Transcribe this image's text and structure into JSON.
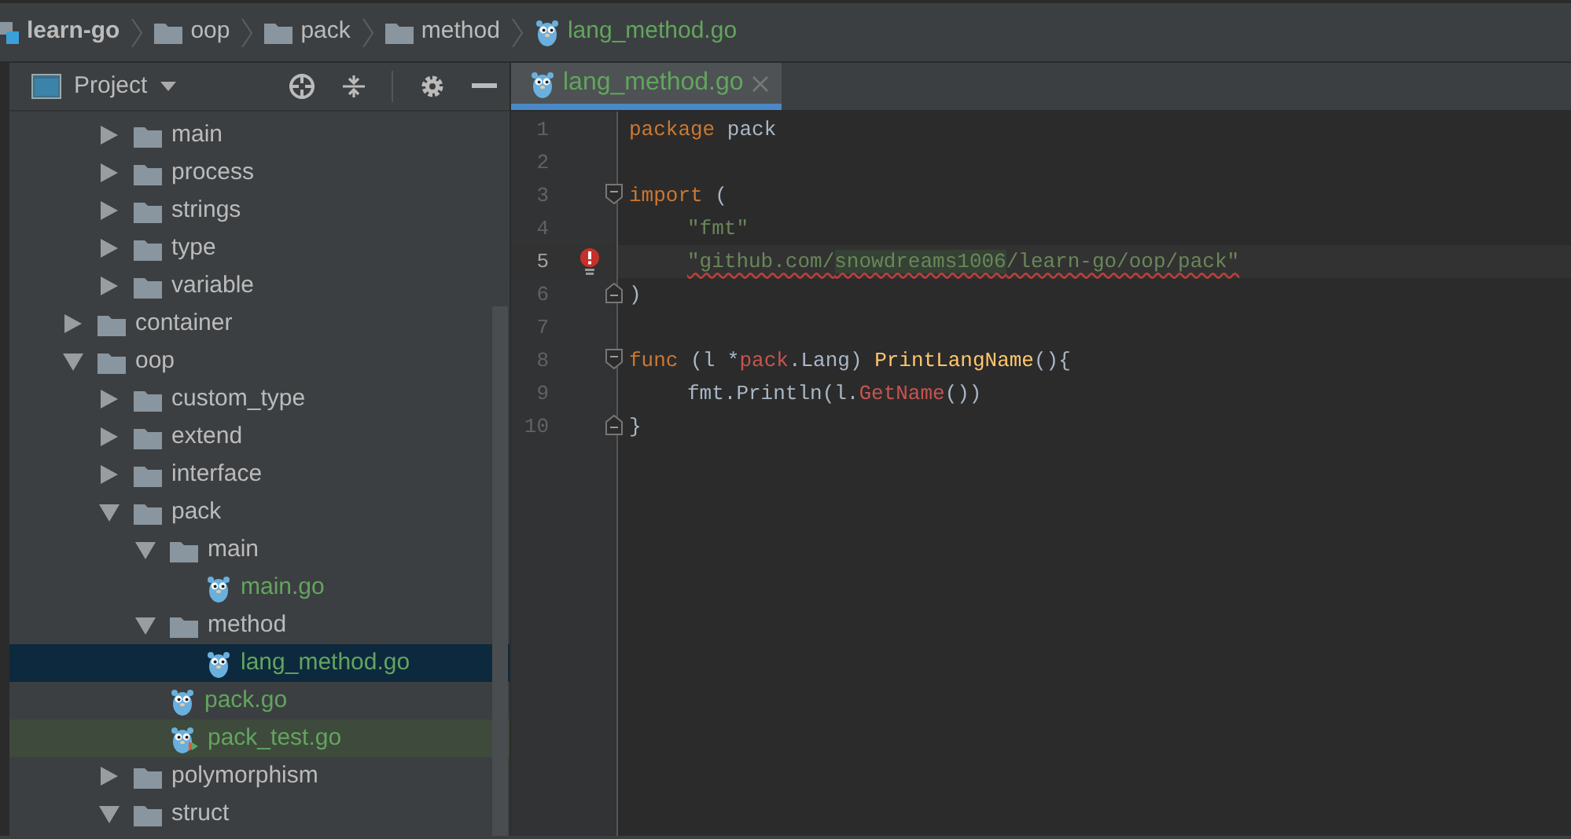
{
  "breadcrumbs": [
    {
      "label": "learn-go",
      "kind": "project"
    },
    {
      "label": "oop",
      "kind": "folder"
    },
    {
      "label": "pack",
      "kind": "folder"
    },
    {
      "label": "method",
      "kind": "folder"
    },
    {
      "label": "lang_method.go",
      "kind": "gofile"
    }
  ],
  "panel": {
    "title": "Project"
  },
  "tree": {
    "partial": [
      {
        "label": "main",
        "kind": "folder",
        "expanded": false
      },
      {
        "label": "process",
        "kind": "folder",
        "expanded": false
      },
      {
        "label": "strings",
        "kind": "folder",
        "expanded": false
      },
      {
        "label": "type",
        "kind": "folder",
        "expanded": false
      },
      {
        "label": "variable",
        "kind": "folder",
        "expanded": false
      }
    ],
    "items": [
      {
        "label": "container",
        "kind": "folder",
        "expanded": false
      },
      {
        "label": "oop",
        "kind": "folder",
        "expanded": true,
        "children": [
          {
            "label": "custom_type",
            "kind": "folder",
            "expanded": false
          },
          {
            "label": "extend",
            "kind": "folder",
            "expanded": false
          },
          {
            "label": "interface",
            "kind": "folder",
            "expanded": false
          },
          {
            "label": "pack",
            "kind": "folder",
            "expanded": true,
            "children": [
              {
                "label": "main",
                "kind": "folder",
                "expanded": true,
                "children": [
                  {
                    "label": "main.go",
                    "kind": "gofile",
                    "selected": false
                  }
                ]
              },
              {
                "label": "method",
                "kind": "folder",
                "expanded": true,
                "children": [
                  {
                    "label": "lang_method.go",
                    "kind": "gofile",
                    "selected": true
                  }
                ]
              },
              {
                "label": "pack.go",
                "kind": "gofile",
                "selected": false
              },
              {
                "label": "pack_test.go",
                "kind": "testfile",
                "selected": false
              }
            ]
          },
          {
            "label": "polymorphism",
            "kind": "folder",
            "expanded": false
          },
          {
            "label": "struct",
            "kind": "folder",
            "expanded": true
          }
        ]
      }
    ]
  },
  "editor": {
    "tabs": [
      {
        "label": "lang_method.go",
        "selected": true
      }
    ],
    "lines": [
      {
        "number": "1",
        "tokens": [
          {
            "text": "package",
            "kind": "keyword"
          },
          {
            "text": " pack",
            "kind": "plain"
          }
        ]
      },
      {
        "number": "2"
      },
      {
        "number": "3",
        "fold_start": true,
        "tokens": [
          {
            "text": "import",
            "kind": "keyword"
          },
          {
            "text": " (",
            "kind": "plain"
          }
        ]
      },
      {
        "number": "4",
        "indent": true,
        "tokens": [
          {
            "text": "\"fmt\"",
            "kind": "string"
          }
        ]
      },
      {
        "number": "5",
        "current": true,
        "error": true,
        "indent": true,
        "tokens": [
          {
            "text": "\"github.com/",
            "kind": "string",
            "squiggle": true
          },
          {
            "text": "snowdreams1006",
            "kind": "string",
            "squiggle": true,
            "highlight": true
          },
          {
            "text": "/learn-go/oop/pack\"",
            "kind": "string",
            "squiggle": true
          }
        ]
      },
      {
        "number": "6",
        "fold_end": true,
        "tokens": [
          {
            "text": ")",
            "kind": "plain"
          }
        ]
      },
      {
        "number": "7"
      },
      {
        "number": "8",
        "fold_start": true,
        "tokens": [
          {
            "text": "func",
            "kind": "keyword"
          },
          {
            "text": " (l *",
            "kind": "plain"
          },
          {
            "text": "pack",
            "kind": "package"
          },
          {
            "text": ".Lang) ",
            "kind": "plain"
          },
          {
            "text": "PrintLangName",
            "kind": "function"
          },
          {
            "text": "(){",
            "kind": "plain"
          }
        ]
      },
      {
        "number": "9",
        "indent": true,
        "tokens": [
          {
            "text": "fmt.Println(l.",
            "kind": "plain"
          },
          {
            "text": "GetName",
            "kind": "package"
          },
          {
            "text": "())",
            "kind": "plain"
          }
        ]
      },
      {
        "number": "10",
        "fold_end": true,
        "tokens": [
          {
            "text": "}",
            "kind": "plain"
          }
        ]
      }
    ]
  }
}
